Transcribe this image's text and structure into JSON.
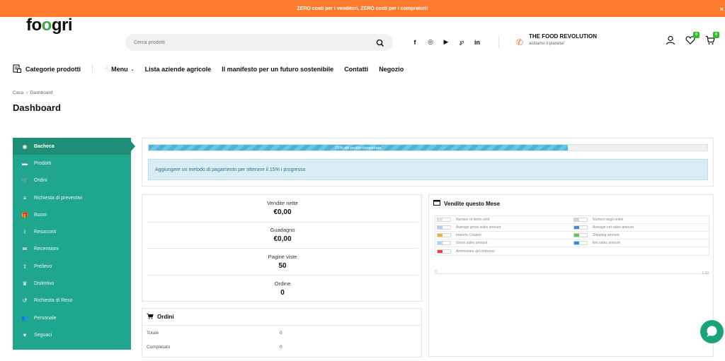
{
  "announcement": {
    "text": "ZERO costi per i venditori, ZERO costi per i compratori!",
    "close": "×"
  },
  "header": {
    "logo": {
      "part1": "fo",
      "leaf": "o",
      "part2": "gri"
    },
    "search": {
      "placeholder": "Cerca prodotti"
    },
    "socials": [
      "f",
      "◎",
      "▶",
      "℘",
      "in"
    ],
    "tagline": {
      "title": "THE FOOD REVOLUTION",
      "subtitle": "aiutiamo il pianeta!"
    },
    "wishlist_count": "0",
    "cart_count": "0"
  },
  "nav": {
    "categories_label": "Categorie prodotti",
    "menu_label": "Menu",
    "items": [
      "Lista aziende agricole",
      "Il manifesto per un futuro sostenibile",
      "Contatti",
      "Negozio"
    ]
  },
  "breadcrumb": {
    "home": "Casa",
    "separator": "›",
    "current": "Dashboard"
  },
  "page_title": "Dashboard",
  "sidebar": {
    "items": [
      {
        "label": "Bacheca",
        "icon": "dashboard-icon",
        "glyph": "◉"
      },
      {
        "label": "Prodotti",
        "icon": "briefcase-icon",
        "glyph": "▬"
      },
      {
        "label": "Ordini",
        "icon": "cart-icon",
        "glyph": "🛒"
      },
      {
        "label": "Richiesta di preventivi",
        "icon": "list-icon",
        "glyph": "≡"
      },
      {
        "label": "Buoni",
        "icon": "gift-icon",
        "glyph": "🎁"
      },
      {
        "label": "Resoconti",
        "icon": "chart-icon",
        "glyph": "⌇"
      },
      {
        "label": "Recensioni",
        "icon": "comments-icon",
        "glyph": "✉"
      },
      {
        "label": "Prelievo",
        "icon": "upload-icon",
        "glyph": "⇧"
      },
      {
        "label": "Distintivo",
        "icon": "badge-icon",
        "glyph": "♛"
      },
      {
        "label": "Richiesta di Reso",
        "icon": "undo-icon",
        "glyph": "↺"
      },
      {
        "label": "Personale",
        "icon": "users-icon",
        "glyph": "👥"
      },
      {
        "label": "Seguaci",
        "icon": "heart-icon",
        "glyph": "♥"
      },
      {
        "label": "",
        "icon": "more-icon",
        "glyph": "·"
      }
    ]
  },
  "profile_progress": {
    "percent": 75,
    "label": "75% del profilo completata",
    "notice": "Aggiungere un metodo di pagamento per ottenere il 15% i progresso"
  },
  "stats": [
    {
      "label": "Vendite nette",
      "value": "€0,00"
    },
    {
      "label": "Guadagno",
      "value": "€0,00"
    },
    {
      "label": "Pagine viste",
      "value": "50"
    },
    {
      "label": "Ordine",
      "value": "0"
    }
  ],
  "orders": {
    "title": "Ordini",
    "rows": [
      {
        "label": "Totale",
        "value": "0"
      },
      {
        "label": "Completato",
        "value": "0"
      }
    ]
  },
  "sales_month": {
    "title": "Vendite questo Mese",
    "legend": [
      {
        "label": "Number of items sold",
        "color": "#e6e6e6"
      },
      {
        "label": "Numero degli ordini",
        "color": "#d4d4d4"
      },
      {
        "label": "Average gross sales amount",
        "color": "#b1d4ea"
      },
      {
        "label": "Average net sales amount",
        "color": "#3c8fd0"
      },
      {
        "label": "Importo Coupon",
        "color": "#f0b429"
      },
      {
        "label": "Shipping amount",
        "color": "#5fc35a"
      },
      {
        "label": "Gross sales amount",
        "color": "#a8d8ea"
      },
      {
        "label": "Net sales amount",
        "color": "#2f8ad8"
      },
      {
        "label": "Ammontare del rimborso",
        "color": "#e8433a"
      }
    ],
    "axis_left": "0",
    "axis_right": "1.00"
  },
  "colors": {
    "accent": "#20a58e",
    "topbar": "#ff7b2e",
    "badge": "#2fc12b"
  }
}
